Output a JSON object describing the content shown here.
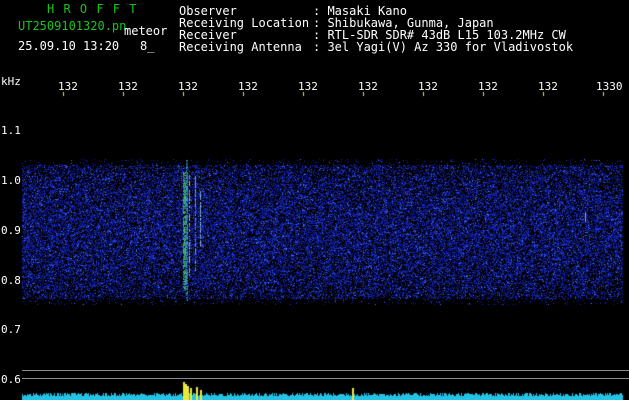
{
  "header": {
    "brand": "H R O F F T",
    "filename": "UT2509101320.pn",
    "mode": "meteor",
    "datetime": "25.09.10 13:20",
    "count": "8_",
    "info": [
      {
        "label": "Observer",
        "value": ": Masaki Kano"
      },
      {
        "label": "Receiving Location",
        "value": ": Shibukawa, Gunma, Japan"
      },
      {
        "label": "Receiver",
        "value": ": RTL-SDR SDR# 43dB L15 103.2MHz CW"
      },
      {
        "label": "Receiving Antenna",
        "value": ": 3el Yagi(V) Az 330 for Vladivostok"
      }
    ]
  },
  "axes": {
    "y_unit": "kHz",
    "x_ticks": [
      "132",
      "132",
      "132",
      "132",
      "132",
      "132",
      "132",
      "132",
      "132",
      "1330"
    ],
    "y_ticks": [
      "1.1",
      "1.0",
      "0.9",
      "0.8",
      "0.7",
      "0.6"
    ]
  },
  "colors": {
    "background": "#000000",
    "header_green": "#19c419",
    "header_white": "#ffffff",
    "tick_yellow": "#e9e93a",
    "baseline_cyan": "#23c3e6"
  }
}
